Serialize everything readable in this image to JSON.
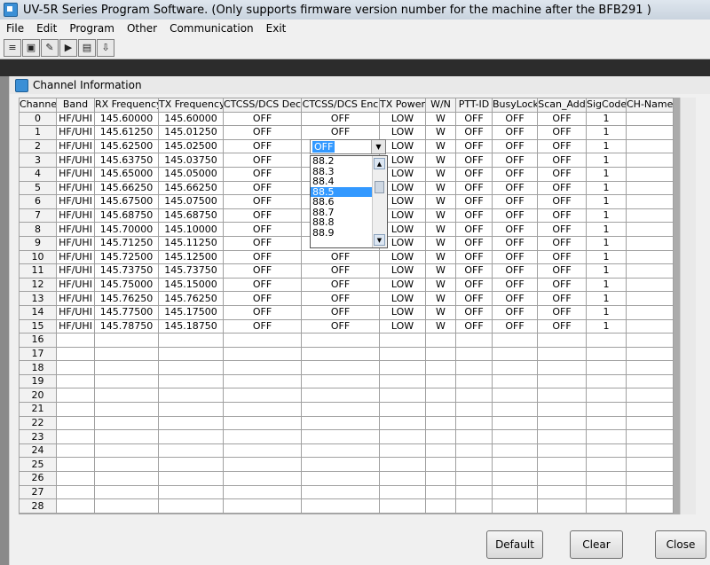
{
  "window": {
    "title": "UV-5R Series Program Software. (Only supports firmware version number for the machine after the BFB291 )"
  },
  "menu": [
    "File",
    "Edit",
    "Program",
    "Other",
    "Communication",
    "Exit"
  ],
  "toolbar": [
    {
      "name": "read-icon",
      "glyph": "≡"
    },
    {
      "name": "save-icon",
      "glyph": "▣"
    },
    {
      "name": "write-icon",
      "glyph": "✎"
    },
    {
      "name": "program-icon",
      "glyph": "▶"
    },
    {
      "name": "open-icon",
      "glyph": "▤"
    },
    {
      "name": "export-icon",
      "glyph": "⇩"
    }
  ],
  "child": {
    "title": "Channel Information"
  },
  "columns": [
    {
      "label": "Channel",
      "w": 42
    },
    {
      "label": "Band",
      "w": 43
    },
    {
      "label": "RX Frequency",
      "w": 72
    },
    {
      "label": "TX Frequency",
      "w": 73
    },
    {
      "label": "CTCSS/DCS Dec",
      "w": 88
    },
    {
      "label": "CTCSS/DCS Enc",
      "w": 88
    },
    {
      "label": "TX Power",
      "w": 52
    },
    {
      "label": "W/N",
      "w": 34
    },
    {
      "label": "PTT-ID",
      "w": 41
    },
    {
      "label": "BusyLock",
      "w": 51
    },
    {
      "label": "Scan_Add",
      "w": 55
    },
    {
      "label": "SigCode",
      "w": 45
    },
    {
      "label": "CH-Name",
      "w": 53
    }
  ],
  "rows": [
    [
      "0",
      "HF/UHI",
      "145.60000",
      "145.60000",
      "OFF",
      "OFF",
      "LOW",
      "W",
      "OFF",
      "OFF",
      "OFF",
      "1",
      ""
    ],
    [
      "1",
      "HF/UHI",
      "145.61250",
      "145.01250",
      "OFF",
      "OFF",
      "LOW",
      "W",
      "OFF",
      "OFF",
      "OFF",
      "1",
      ""
    ],
    [
      "2",
      "HF/UHI",
      "145.62500",
      "145.02500",
      "OFF",
      "",
      "LOW",
      "W",
      "OFF",
      "OFF",
      "OFF",
      "1",
      ""
    ],
    [
      "3",
      "HF/UHI",
      "145.63750",
      "145.03750",
      "OFF",
      "",
      "LOW",
      "W",
      "OFF",
      "OFF",
      "OFF",
      "1",
      ""
    ],
    [
      "4",
      "HF/UHI",
      "145.65000",
      "145.05000",
      "OFF",
      "",
      "LOW",
      "W",
      "OFF",
      "OFF",
      "OFF",
      "1",
      ""
    ],
    [
      "5",
      "HF/UHI",
      "145.66250",
      "145.66250",
      "OFF",
      "",
      "LOW",
      "W",
      "OFF",
      "OFF",
      "OFF",
      "1",
      ""
    ],
    [
      "6",
      "HF/UHI",
      "145.67500",
      "145.07500",
      "OFF",
      "",
      "LOW",
      "W",
      "OFF",
      "OFF",
      "OFF",
      "1",
      ""
    ],
    [
      "7",
      "HF/UHI",
      "145.68750",
      "145.68750",
      "OFF",
      "",
      "LOW",
      "W",
      "OFF",
      "OFF",
      "OFF",
      "1",
      ""
    ],
    [
      "8",
      "HF/UHI",
      "145.70000",
      "145.10000",
      "OFF",
      "",
      "LOW",
      "W",
      "OFF",
      "OFF",
      "OFF",
      "1",
      ""
    ],
    [
      "9",
      "HF/UHI",
      "145.71250",
      "145.11250",
      "OFF",
      "",
      "LOW",
      "W",
      "OFF",
      "OFF",
      "OFF",
      "1",
      ""
    ],
    [
      "10",
      "HF/UHI",
      "145.72500",
      "145.12500",
      "OFF",
      "OFF",
      "LOW",
      "W",
      "OFF",
      "OFF",
      "OFF",
      "1",
      ""
    ],
    [
      "11",
      "HF/UHI",
      "145.73750",
      "145.73750",
      "OFF",
      "OFF",
      "LOW",
      "W",
      "OFF",
      "OFF",
      "OFF",
      "1",
      ""
    ],
    [
      "12",
      "HF/UHI",
      "145.75000",
      "145.15000",
      "OFF",
      "OFF",
      "LOW",
      "W",
      "OFF",
      "OFF",
      "OFF",
      "1",
      ""
    ],
    [
      "13",
      "HF/UHI",
      "145.76250",
      "145.76250",
      "OFF",
      "OFF",
      "LOW",
      "W",
      "OFF",
      "OFF",
      "OFF",
      "1",
      ""
    ],
    [
      "14",
      "HF/UHI",
      "145.77500",
      "145.17500",
      "OFF",
      "OFF",
      "LOW",
      "W",
      "OFF",
      "OFF",
      "OFF",
      "1",
      ""
    ],
    [
      "15",
      "HF/UHI",
      "145.78750",
      "145.18750",
      "OFF",
      "OFF",
      "LOW",
      "W",
      "OFF",
      "OFF",
      "OFF",
      "1",
      ""
    ],
    [
      "16",
      "",
      "",
      "",
      "",
      "",
      "",
      "",
      "",
      "",
      "",
      "",
      ""
    ],
    [
      "17",
      "",
      "",
      "",
      "",
      "",
      "",
      "",
      "",
      "",
      "",
      "",
      ""
    ],
    [
      "18",
      "",
      "",
      "",
      "",
      "",
      "",
      "",
      "",
      "",
      "",
      "",
      ""
    ],
    [
      "19",
      "",
      "",
      "",
      "",
      "",
      "",
      "",
      "",
      "",
      "",
      "",
      ""
    ],
    [
      "20",
      "",
      "",
      "",
      "",
      "",
      "",
      "",
      "",
      "",
      "",
      "",
      ""
    ],
    [
      "21",
      "",
      "",
      "",
      "",
      "",
      "",
      "",
      "",
      "",
      "",
      "",
      ""
    ],
    [
      "22",
      "",
      "",
      "",
      "",
      "",
      "",
      "",
      "",
      "",
      "",
      "",
      ""
    ],
    [
      "23",
      "",
      "",
      "",
      "",
      "",
      "",
      "",
      "",
      "",
      "",
      "",
      ""
    ],
    [
      "24",
      "",
      "",
      "",
      "",
      "",
      "",
      "",
      "",
      "",
      "",
      "",
      ""
    ],
    [
      "25",
      "",
      "",
      "",
      "",
      "",
      "",
      "",
      "",
      "",
      "",
      "",
      ""
    ],
    [
      "26",
      "",
      "",
      "",
      "",
      "",
      "",
      "",
      "",
      "",
      "",
      "",
      ""
    ],
    [
      "27",
      "",
      "",
      "",
      "",
      "",
      "",
      "",
      "",
      "",
      "",
      "",
      ""
    ],
    [
      "28",
      "",
      "",
      "",
      "",
      "",
      "",
      "",
      "",
      "",
      "",
      "",
      ""
    ]
  ],
  "editor": {
    "value": "OFF",
    "options": [
      "88.2",
      "88.3",
      "88.4",
      "88.5",
      "88.6",
      "88.7",
      "88.8",
      "88.9"
    ],
    "highlighted": "88.5"
  },
  "buttons": {
    "default": "Default",
    "clear": "Clear",
    "close": "Close"
  }
}
